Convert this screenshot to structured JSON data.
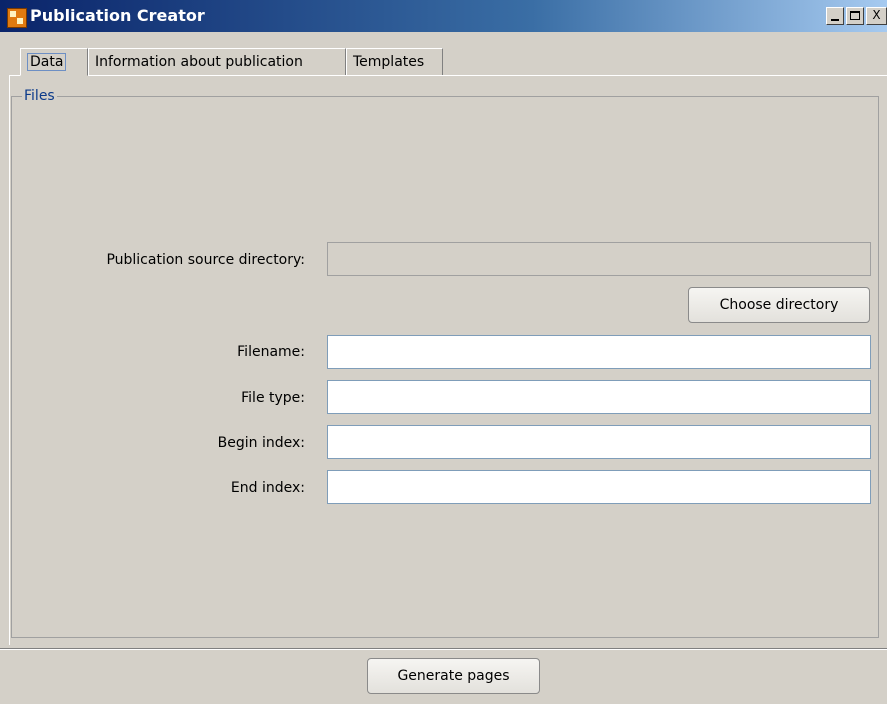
{
  "window": {
    "title": "Publication Creator",
    "min_glyph": "_",
    "max_glyph": "□",
    "close_glyph": "X"
  },
  "tabs": [
    {
      "label": "Data",
      "active": true
    },
    {
      "label": "Information about publication",
      "active": false
    },
    {
      "label": "Templates",
      "active": false
    }
  ],
  "files": {
    "legend": "Files",
    "source_dir": {
      "label": "Publication source directory:",
      "value": ""
    },
    "choose_dir_button": "Choose directory",
    "filename": {
      "label": "Filename:",
      "value": ""
    },
    "file_type": {
      "label": "File type:",
      "value": ""
    },
    "begin_index": {
      "label": "Begin index:",
      "value": ""
    },
    "end_index": {
      "label": "End index:",
      "value": ""
    }
  },
  "generate_button": "Generate pages"
}
